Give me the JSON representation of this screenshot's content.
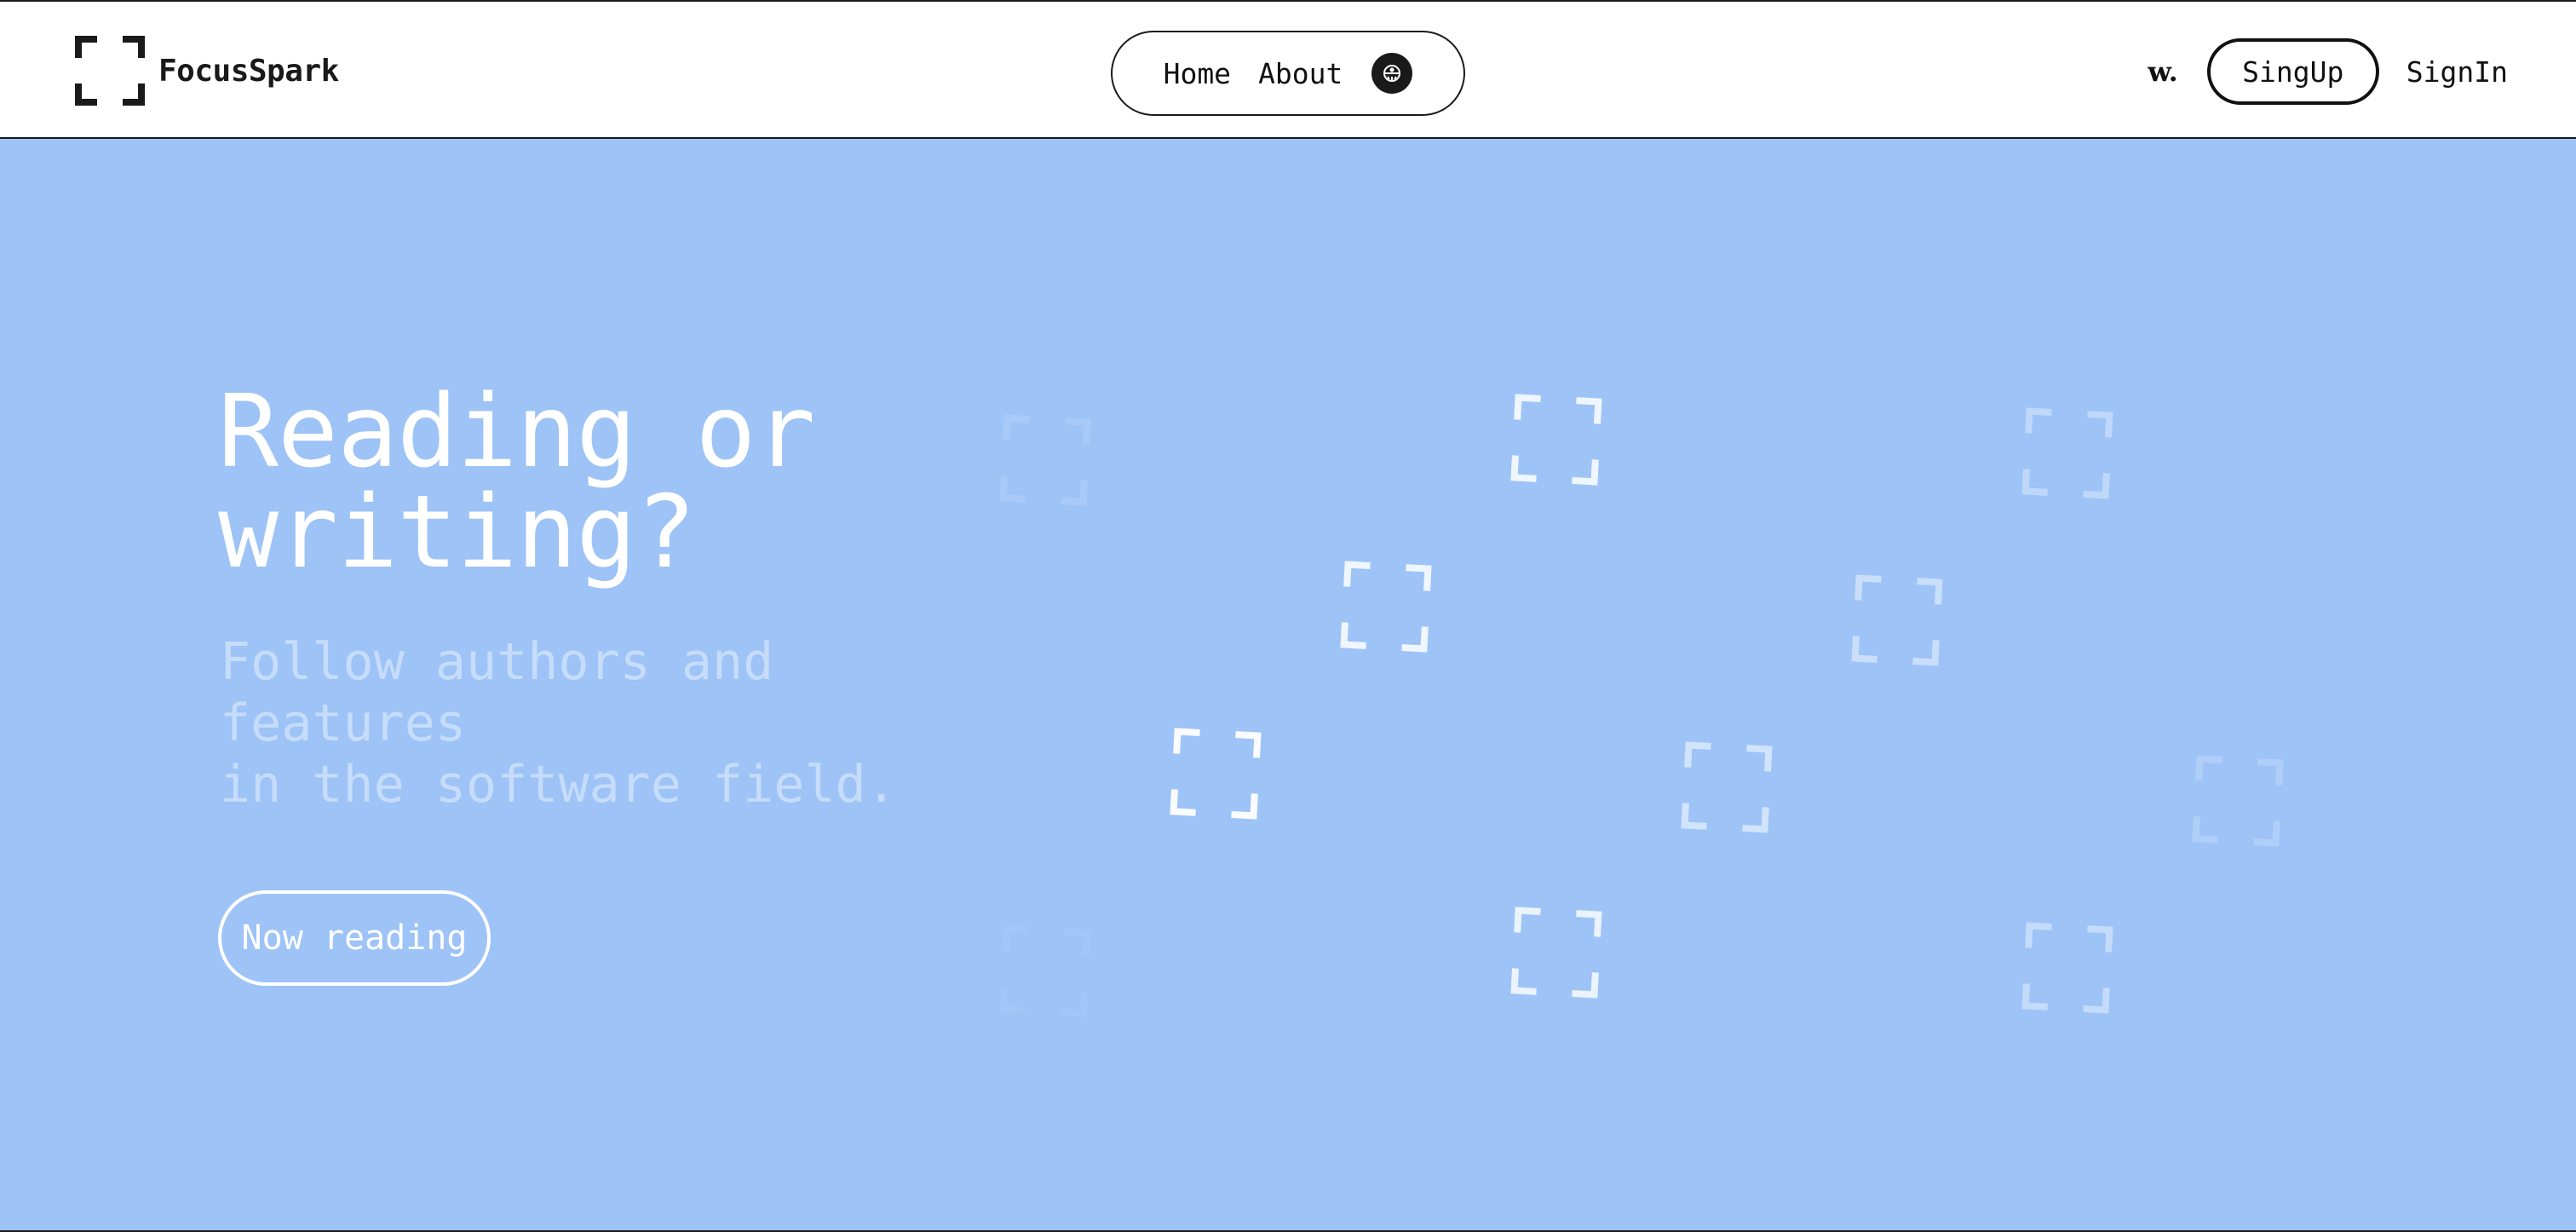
{
  "header": {
    "brand": {
      "name": "FocusSpark",
      "icon": "focus-frame-icon"
    },
    "nav": {
      "home_label": "Home",
      "about_label": "About",
      "theme_icon": "sun-moon-icon"
    },
    "right": {
      "w_logo": "w.",
      "signup_label": "SingUp",
      "signin_label": "SignIn"
    }
  },
  "hero": {
    "title": "Reading or\nwriting?",
    "subtitle": "Follow authors and\nfeatures\nin the software field.",
    "cta_label": "Now reading",
    "background_color": "#9dc3f7",
    "decoration_icon": "focus-frame-icon"
  },
  "colors": {
    "accent_dark": "#1a1a1a",
    "hero_bg": "#9dc3f7",
    "hero_text": "#ffffff"
  }
}
